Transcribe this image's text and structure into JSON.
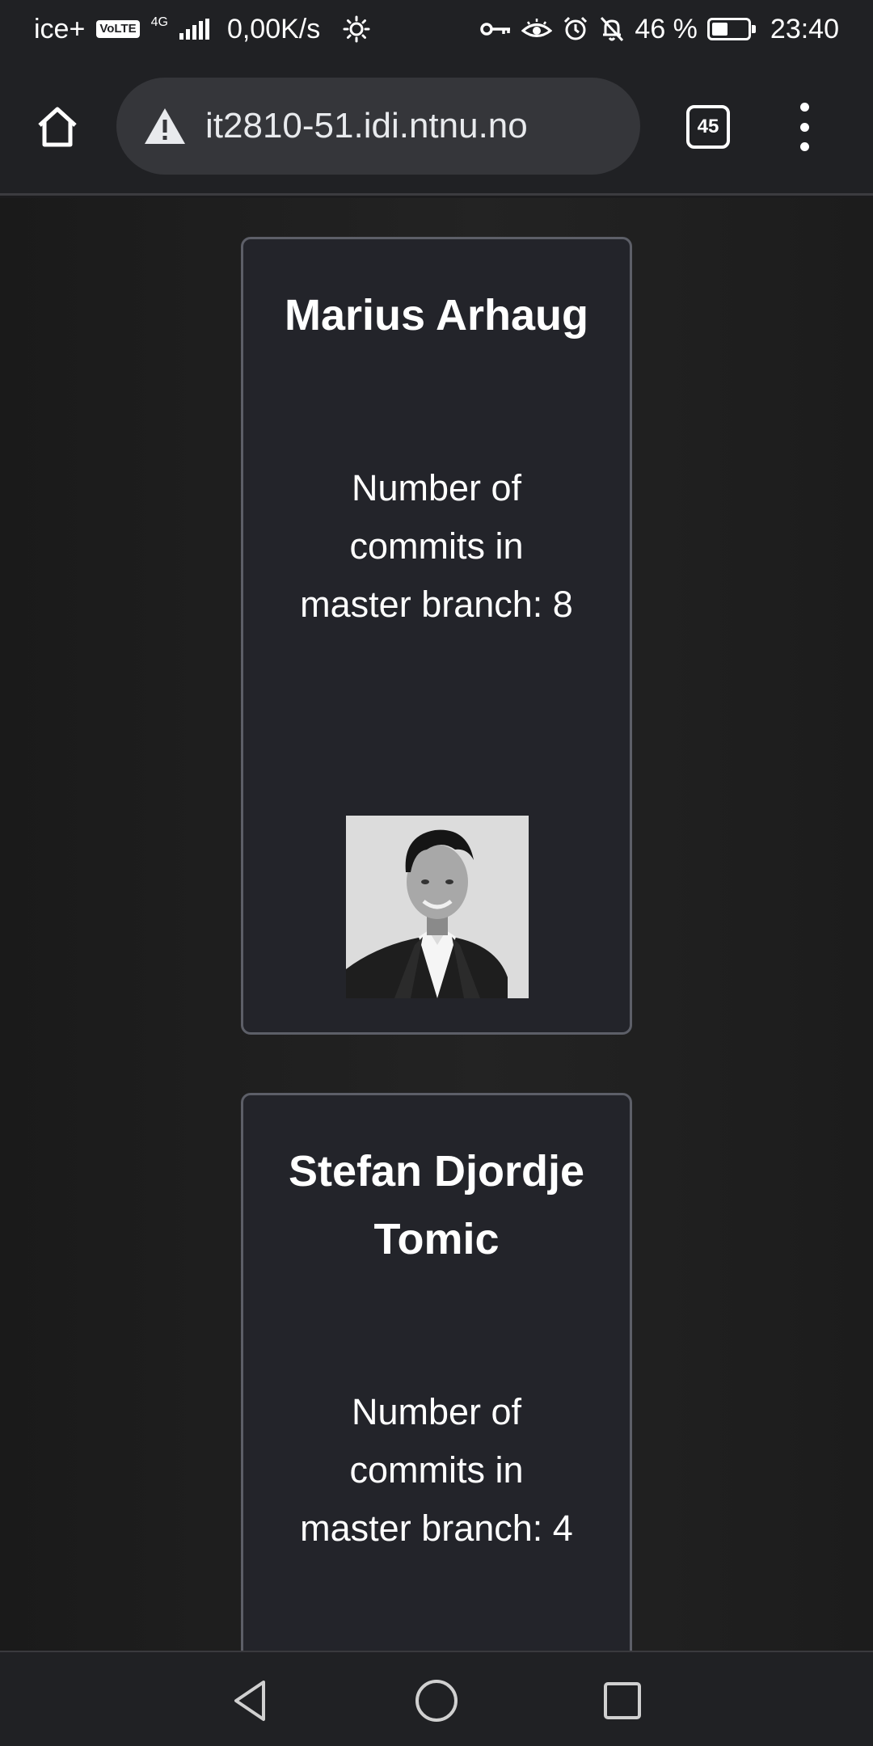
{
  "status_bar": {
    "carrier": "ice+",
    "volte": "VoLTE",
    "network": "4G",
    "net_speed": "0,00K/s",
    "battery_percent": "46 %",
    "battery_level": 0.46,
    "time": "23:40",
    "icons": [
      "brightness-icon",
      "vpn-key-icon",
      "eye-comfort-icon",
      "alarm-icon",
      "bell-off-icon",
      "battery-icon"
    ]
  },
  "browser": {
    "url": "it2810-51.idi.ntnu.no",
    "tab_count": "45",
    "icons": [
      "home-icon",
      "warning-icon",
      "tabs-icon",
      "more-vert-icon"
    ]
  },
  "cards": [
    {
      "name": "Marius Arhaug",
      "commits": "Number of commits in master branch: 8",
      "photo": "profile-photo"
    },
    {
      "name": "Stefan Djordje Tomic",
      "commits": "Number of commits in master branch: 4"
    }
  ],
  "nav": {
    "icons": [
      "back-icon",
      "home-circle-icon",
      "recents-icon"
    ]
  },
  "colors": {
    "background": "#1c1c1e",
    "card_background": "#23242a",
    "card_border": "#5d5f68",
    "toolbar": "#202124",
    "urlbar": "#35363a"
  }
}
